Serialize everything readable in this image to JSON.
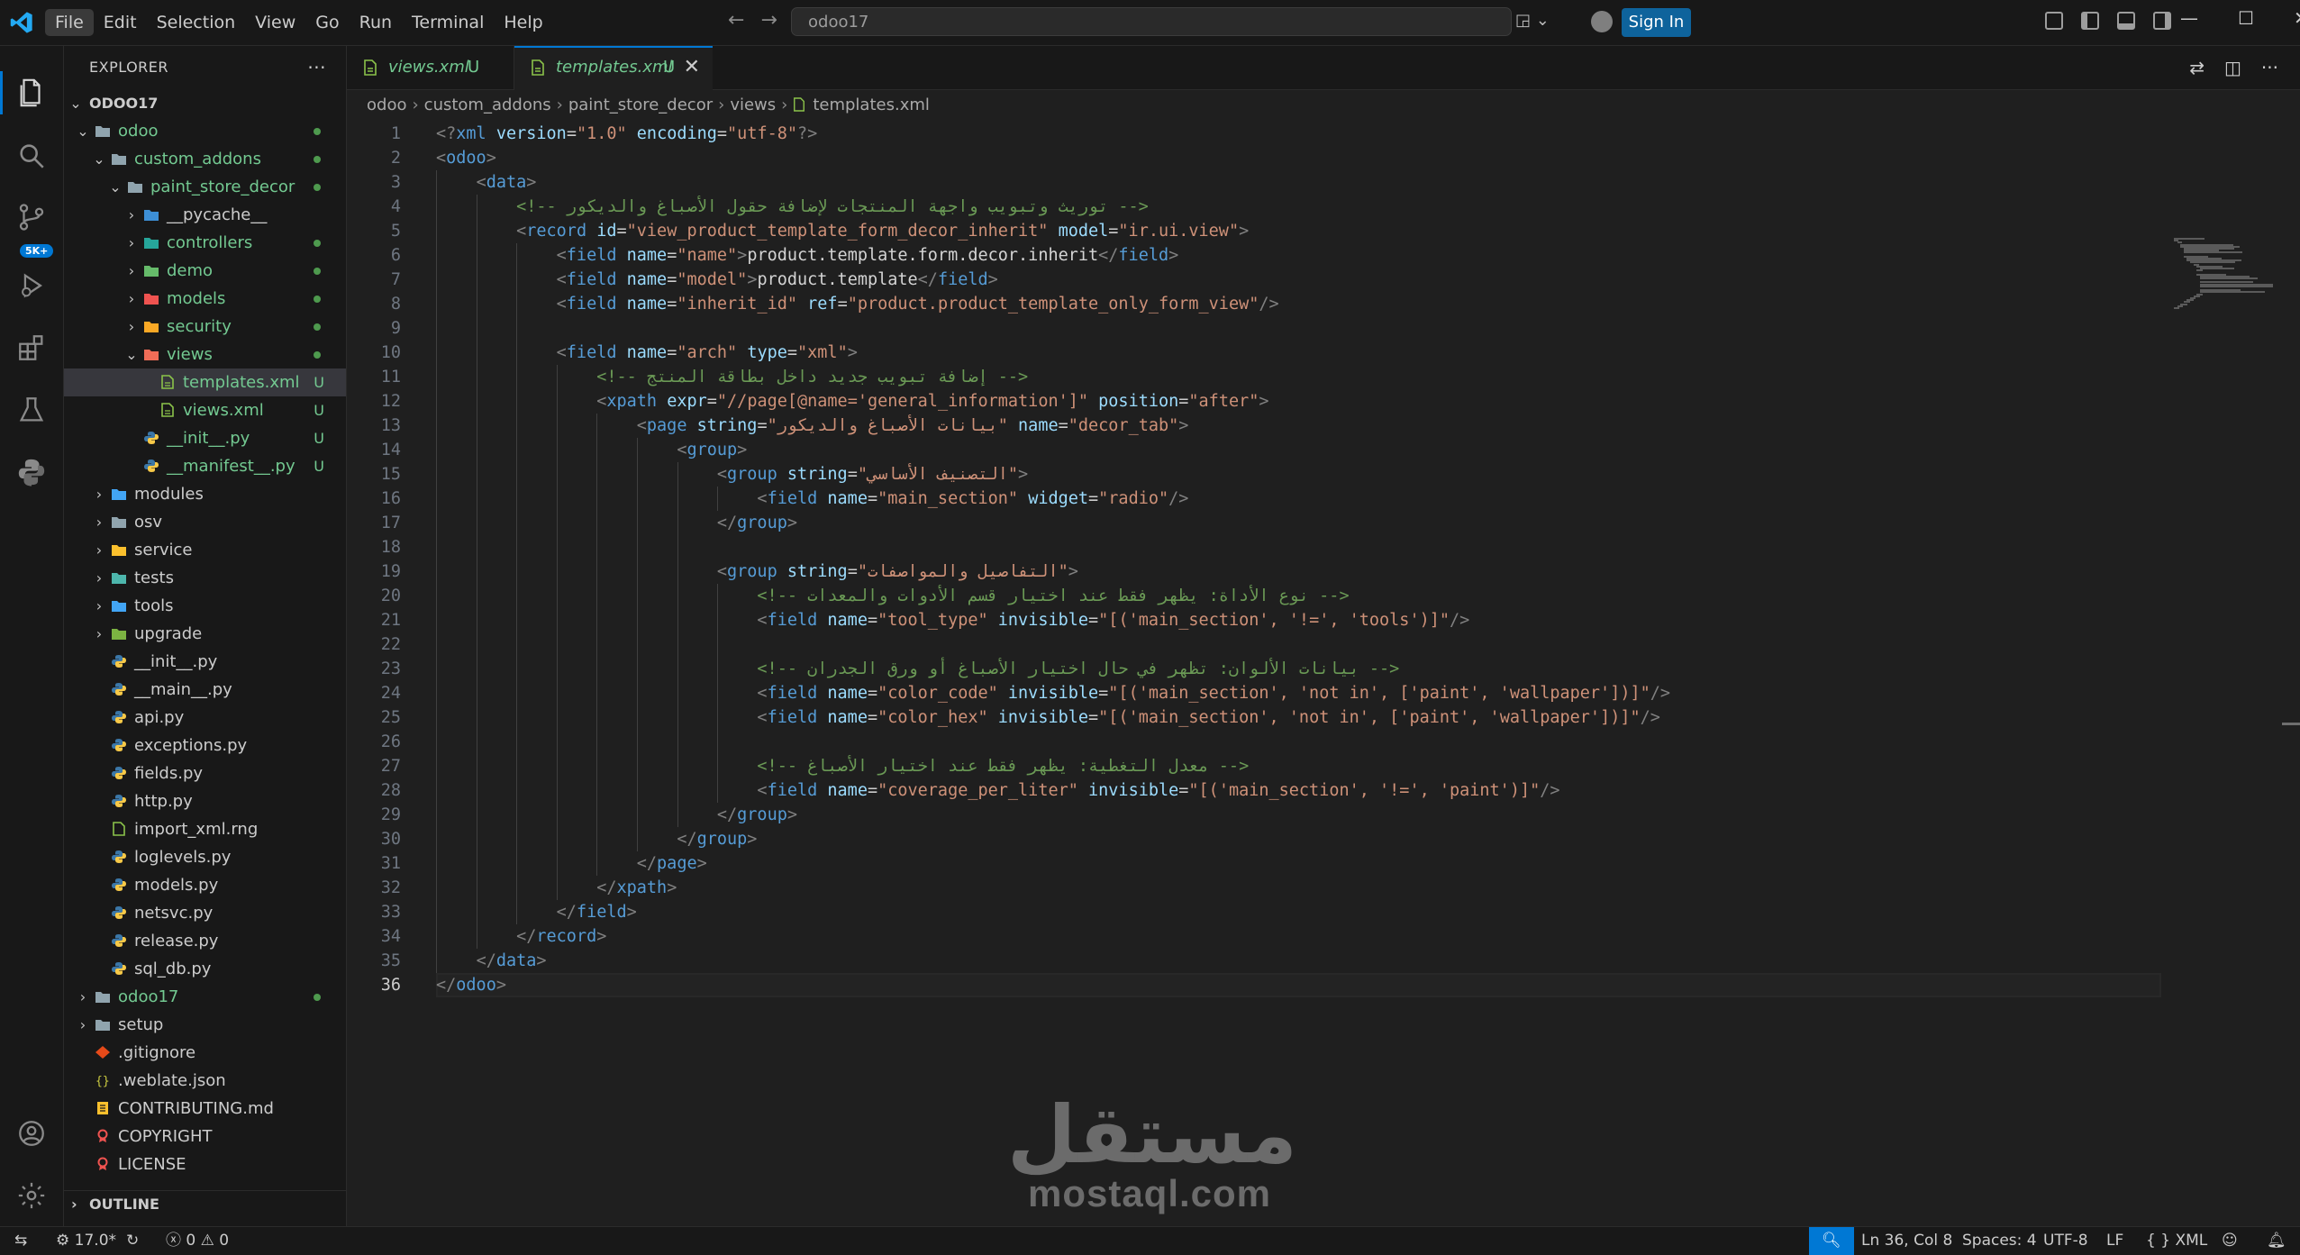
{
  "titlebar": {
    "menu": [
      "File",
      "Edit",
      "Selection",
      "View",
      "Go",
      "Run",
      "Terminal",
      "Help"
    ],
    "search_text": "odoo17",
    "sign_in": "Sign In"
  },
  "activitybar": {
    "source_control_badge": "5K+"
  },
  "sidebar": {
    "title": "EXPLORER",
    "more": "···",
    "root": "ODOO17",
    "outline": "OUTLINE",
    "items": [
      {
        "label": "odoo",
        "type": "folder",
        "open": true,
        "depth": 1,
        "color": "green",
        "decor": "dot"
      },
      {
        "label": "custom_addons",
        "type": "folder",
        "open": true,
        "depth": 2,
        "color": "green",
        "decor": "dot"
      },
      {
        "label": "paint_store_decor",
        "type": "folder",
        "open": true,
        "depth": 3,
        "color": "green",
        "decor": "dot"
      },
      {
        "label": "__pycache__",
        "type": "folder",
        "open": false,
        "depth": 4,
        "color": "white",
        "icon": "pycache-folder-icon",
        "decor": ""
      },
      {
        "label": "controllers",
        "type": "folder",
        "open": false,
        "depth": 4,
        "color": "green",
        "icon": "controller-folder-icon",
        "decor": "dot"
      },
      {
        "label": "demo",
        "type": "folder",
        "open": false,
        "depth": 4,
        "color": "green",
        "icon": "demo-folder-icon",
        "decor": "dot"
      },
      {
        "label": "models",
        "type": "folder",
        "open": false,
        "depth": 4,
        "color": "green",
        "icon": "models-folder-icon",
        "decor": "dot"
      },
      {
        "label": "security",
        "type": "folder",
        "open": false,
        "depth": 4,
        "color": "green",
        "icon": "security-folder-icon",
        "decor": "dot"
      },
      {
        "label": "views",
        "type": "folder",
        "open": true,
        "depth": 4,
        "color": "green",
        "icon": "views-folder-icon",
        "decor": "dot"
      },
      {
        "label": "templates.xml",
        "type": "file",
        "depth": 5,
        "color": "green",
        "icon": "xml-file-icon",
        "decor": "U",
        "selected": true
      },
      {
        "label": "views.xml",
        "type": "file",
        "depth": 5,
        "color": "green",
        "icon": "xml-file-icon",
        "decor": "U"
      },
      {
        "label": "__init__.py",
        "type": "file",
        "depth": 4,
        "color": "green",
        "icon": "python-file-icon",
        "decor": "U"
      },
      {
        "label": "__manifest__.py",
        "type": "file",
        "depth": 4,
        "color": "green",
        "icon": "python-file-icon",
        "decor": "U"
      },
      {
        "label": "modules",
        "type": "folder",
        "open": false,
        "depth": 2,
        "color": "white",
        "icon": "modules-folder-icon",
        "decor": ""
      },
      {
        "label": "osv",
        "type": "folder",
        "open": false,
        "depth": 2,
        "color": "white",
        "icon": "folder-icon",
        "decor": ""
      },
      {
        "label": "service",
        "type": "folder",
        "open": false,
        "depth": 2,
        "color": "white",
        "icon": "service-folder-icon",
        "decor": ""
      },
      {
        "label": "tests",
        "type": "folder",
        "open": false,
        "depth": 2,
        "color": "white",
        "icon": "tests-folder-icon",
        "decor": ""
      },
      {
        "label": "tools",
        "type": "folder",
        "open": false,
        "depth": 2,
        "color": "white",
        "icon": "tools-folder-icon",
        "decor": ""
      },
      {
        "label": "upgrade",
        "type": "folder",
        "open": false,
        "depth": 2,
        "color": "white",
        "icon": "upgrade-folder-icon",
        "decor": ""
      },
      {
        "label": "__init__.py",
        "type": "file",
        "depth": 2,
        "color": "white",
        "icon": "python-file-icon",
        "decor": ""
      },
      {
        "label": "__main__.py",
        "type": "file",
        "depth": 2,
        "color": "white",
        "icon": "python-file-icon",
        "decor": ""
      },
      {
        "label": "api.py",
        "type": "file",
        "depth": 2,
        "color": "white",
        "icon": "python-file-icon",
        "decor": ""
      },
      {
        "label": "exceptions.py",
        "type": "file",
        "depth": 2,
        "color": "white",
        "icon": "python-file-icon",
        "decor": ""
      },
      {
        "label": "fields.py",
        "type": "file",
        "depth": 2,
        "color": "white",
        "icon": "python-file-icon",
        "decor": ""
      },
      {
        "label": "http.py",
        "type": "file",
        "depth": 2,
        "color": "white",
        "icon": "python-file-icon",
        "decor": ""
      },
      {
        "label": "import_xml.rng",
        "type": "file",
        "depth": 2,
        "color": "white",
        "icon": "rng-file-icon",
        "decor": ""
      },
      {
        "label": "loglevels.py",
        "type": "file",
        "depth": 2,
        "color": "white",
        "icon": "python-file-icon",
        "decor": ""
      },
      {
        "label": "models.py",
        "type": "file",
        "depth": 2,
        "color": "white",
        "icon": "python-file-icon",
        "decor": ""
      },
      {
        "label": "netsvc.py",
        "type": "file",
        "depth": 2,
        "color": "white",
        "icon": "python-file-icon",
        "decor": ""
      },
      {
        "label": "release.py",
        "type": "file",
        "depth": 2,
        "color": "white",
        "icon": "python-file-icon",
        "decor": ""
      },
      {
        "label": "sql_db.py",
        "type": "file",
        "depth": 2,
        "color": "white",
        "icon": "python-file-icon",
        "decor": ""
      },
      {
        "label": "odoo17",
        "type": "folder",
        "open": false,
        "depth": 1,
        "color": "green",
        "icon": "folder-icon",
        "decor": "dot"
      },
      {
        "label": "setup",
        "type": "folder",
        "open": false,
        "depth": 1,
        "color": "white",
        "icon": "folder-icon",
        "decor": ""
      },
      {
        "label": ".gitignore",
        "type": "file",
        "depth": 1,
        "color": "white",
        "icon": "git-file-icon",
        "decor": ""
      },
      {
        "label": ".weblate.json",
        "type": "file",
        "depth": 1,
        "color": "white",
        "icon": "json-file-icon",
        "decor": ""
      },
      {
        "label": "CONTRIBUTING.md",
        "type": "file",
        "depth": 1,
        "color": "white",
        "icon": "markdown-file-icon",
        "decor": ""
      },
      {
        "label": "COPYRIGHT",
        "type": "file",
        "depth": 1,
        "color": "white",
        "icon": "license-file-icon",
        "decor": ""
      },
      {
        "label": "LICENSE",
        "type": "file",
        "depth": 1,
        "color": "white",
        "icon": "license-file-icon",
        "decor": ""
      }
    ]
  },
  "tabs": [
    {
      "label": "views.xml",
      "status": "U",
      "active": false
    },
    {
      "label": "templates.xml",
      "status": "U",
      "active": true
    }
  ],
  "breadcrumb": [
    "odoo",
    "custom_addons",
    "paint_store_decor",
    "views",
    "templates.xml"
  ],
  "editor": {
    "current_line": 36,
    "lines": [
      "<?xml version=\"1.0\" encoding=\"utf-8\"?>",
      "<odoo>",
      "    <data>",
      "        <!-- توريث وتبويب واجهة المنتجات لإضافة حقول الأصباغ والديكور -->",
      "        <record id=\"view_product_template_form_decor_inherit\" model=\"ir.ui.view\">",
      "            <field name=\"name\">product.template.form.decor.inherit</field>",
      "            <field name=\"model\">product.template</field>",
      "            <field name=\"inherit_id\" ref=\"product.product_template_only_form_view\"/>",
      "",
      "            <field name=\"arch\" type=\"xml\">",
      "                <!-- إضافة تبويب جديد داخل بطاقة المنتج -->",
      "                <xpath expr=\"//page[@name='general_information']\" position=\"after\">",
      "                    <page string=\"بيانات الأصباغ والديكور\" name=\"decor_tab\">",
      "                        <group>",
      "                            <group string=\"التصنيف الأساسي\">",
      "                                <field name=\"main_section\" widget=\"radio\"/>",
      "                            </group>",
      "",
      "                            <group string=\"التفاصيل والمواصفات\">",
      "                                <!-- نوع الأداة: يظهر فقط عند اختيار قسم الأدوات والمعدات -->",
      "                                <field name=\"tool_type\" invisible=\"[('main_section', '!=', 'tools')]\"/>",
      "",
      "                                <!-- بيانات الألوان: تظهر في حال اختيار الأصباغ أو ورق الجدران -->",
      "                                <field name=\"color_code\" invisible=\"[('main_section', 'not in', ['paint', 'wallpaper'])]\"/>",
      "                                <field name=\"color_hex\" invisible=\"[('main_section', 'not in', ['paint', 'wallpaper'])]\"/>",
      "",
      "                                <!-- معدل التغطية: يظهر فقط عند اختيار الأصباغ -->",
      "                                <field name=\"coverage_per_liter\" invisible=\"[('main_section', '!=', 'paint')]\"/>",
      "                            </group>",
      "                        </group>",
      "                    </page>",
      "                </xpath>",
      "            </field>",
      "        </record>",
      "    </data>",
      "</odoo>"
    ]
  },
  "watermark": {
    "arabic": "مستقل",
    "latin": "mostaql.com"
  },
  "statusbar": {
    "python_version": "17.0*",
    "errors": "0",
    "warnings": "0",
    "cursor": "Ln 36, Col 8",
    "spaces": "Spaces: 4",
    "encoding": "UTF-8",
    "eol": "LF",
    "language": "XML"
  },
  "colors": {
    "accent": "#0078d4",
    "git_untracked": "#73c991",
    "editor_bg": "#1f1f1f",
    "chrome_bg": "#181818"
  }
}
